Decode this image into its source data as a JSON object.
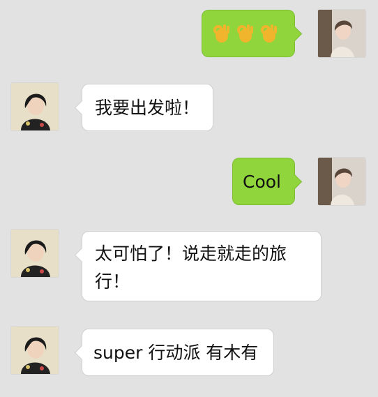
{
  "chat": {
    "messages": [
      {
        "id": 1,
        "direction": "outgoing",
        "type": "emoji",
        "emoji": [
          "👌",
          "👌",
          "👌"
        ],
        "emoji_names": [
          "ok-hand-icon",
          "ok-hand-icon",
          "ok-hand-icon"
        ]
      },
      {
        "id": 2,
        "direction": "incoming",
        "type": "text",
        "text": "我要出发啦！"
      },
      {
        "id": 3,
        "direction": "outgoing",
        "type": "text",
        "text": "Cool"
      },
      {
        "id": 4,
        "direction": "incoming",
        "type": "text",
        "text": "太可怕了！说走就走的旅\n行！"
      },
      {
        "id": 5,
        "direction": "incoming",
        "type": "text",
        "text": "super 行动派 有木有"
      }
    ]
  },
  "colors": {
    "background": "#e2e2e2",
    "outgoing_bubble": "#8fd53b",
    "incoming_bubble": "#ffffff"
  }
}
